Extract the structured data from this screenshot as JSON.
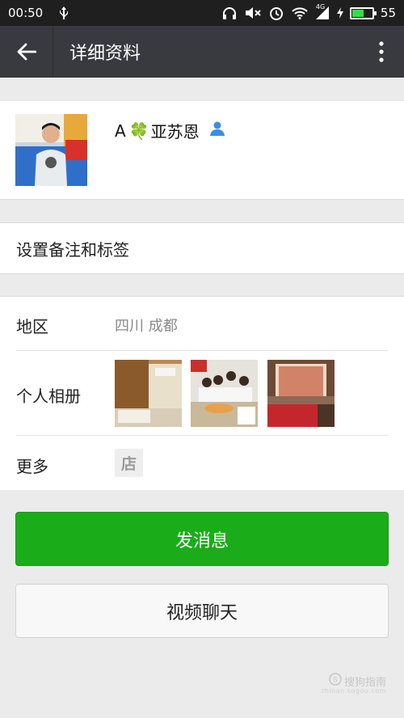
{
  "status_bar": {
    "time": "00:50",
    "network": "4G",
    "battery_percent": "55",
    "battery_level": 0.55
  },
  "header": {
    "back_icon": "arrow-left-icon",
    "title": "详细资料",
    "more_icon": "vertical-dots-icon"
  },
  "profile": {
    "name_prefix": "A",
    "name_emoji": "🍀",
    "name_suffix": "亚苏恩",
    "contact_icon": "person-icon"
  },
  "remark": {
    "label": "设置备注和标签"
  },
  "info": {
    "region_label": "地区",
    "region_value": "四川  成都",
    "album_label": "个人相册",
    "more_label": "更多",
    "shop_icon_text": "店"
  },
  "buttons": {
    "send_message": "发消息",
    "video_chat": "视频聊天"
  },
  "watermark": {
    "text": "搜狗指南",
    "sub": "zhinan.sogou.com"
  },
  "colors": {
    "titlebar": "#393a3f",
    "primary_green": "#1aad19",
    "background": "#ebebeb"
  }
}
